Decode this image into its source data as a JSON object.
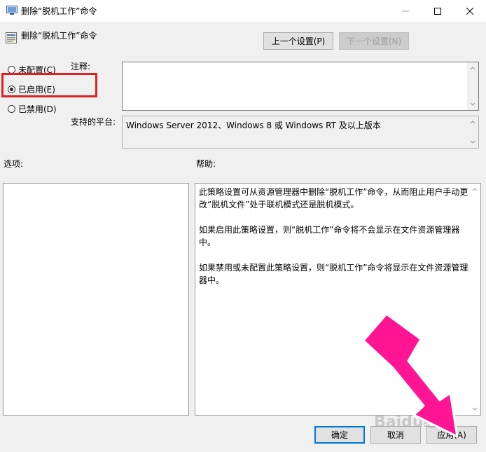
{
  "window": {
    "title": "删除“脱机工作”命令",
    "controls": [
      "minimize-icon",
      "maximize-icon",
      "close-icon"
    ]
  },
  "header": {
    "policy_name": "删除“脱机工作”命令",
    "prev_button": "上一个设置(P)",
    "next_button": "下一个设置(N)"
  },
  "state": {
    "options": [
      {
        "label": "未配置(C)",
        "checked": false
      },
      {
        "label": "已启用(E)",
        "checked": true
      },
      {
        "label": "已禁用(D)",
        "checked": false
      }
    ]
  },
  "comment": {
    "label": "注释:",
    "value": ""
  },
  "platform": {
    "label": "支持的平台:",
    "value": "Windows Server 2012、Windows 8 或 Windows RT 及以上版本"
  },
  "sections": {
    "options_label": "选项:",
    "help_label": "帮助:"
  },
  "help": {
    "text": "此策略设置可从资源管理器中删除“脱机工作”命令，从而阻止用户手动更改“脱机文件”处于联机模式还是脱机模式。\n\n如果启用此策略设置，则“脱机工作”命令将不会显示在文件资源管理器中。\n\n如果禁用或未配置此策略设置，则“脱机工作”命令将显示在文件资源管理器中。"
  },
  "footer": {
    "ok": "确定",
    "cancel": "取消",
    "apply": "应用(A)"
  },
  "overlay": {
    "watermark": "Baidu经验",
    "highlight_color": "#e02020",
    "arrow_color": "#ff1493"
  }
}
